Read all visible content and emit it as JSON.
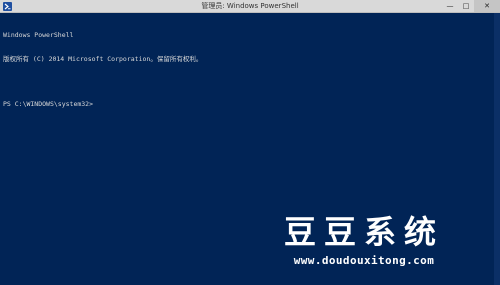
{
  "window": {
    "title": "管理员: Windows PowerShell",
    "minimize_glyph": "—",
    "maximize_glyph": "□",
    "close_glyph": "✕"
  },
  "console": {
    "lines": [
      "Windows PowerShell",
      "版权所有 (C) 2014 Microsoft Corporation。保留所有权利。",
      "",
      "PS C:\\WINDOWS\\system32>"
    ]
  },
  "watermark": {
    "title": "豆豆系统",
    "url": "www.doudouxitong.com"
  },
  "colors": {
    "console_bg": "#012456",
    "titlebar_bg": "#d9d9d9",
    "text": "#d9d9d9"
  }
}
